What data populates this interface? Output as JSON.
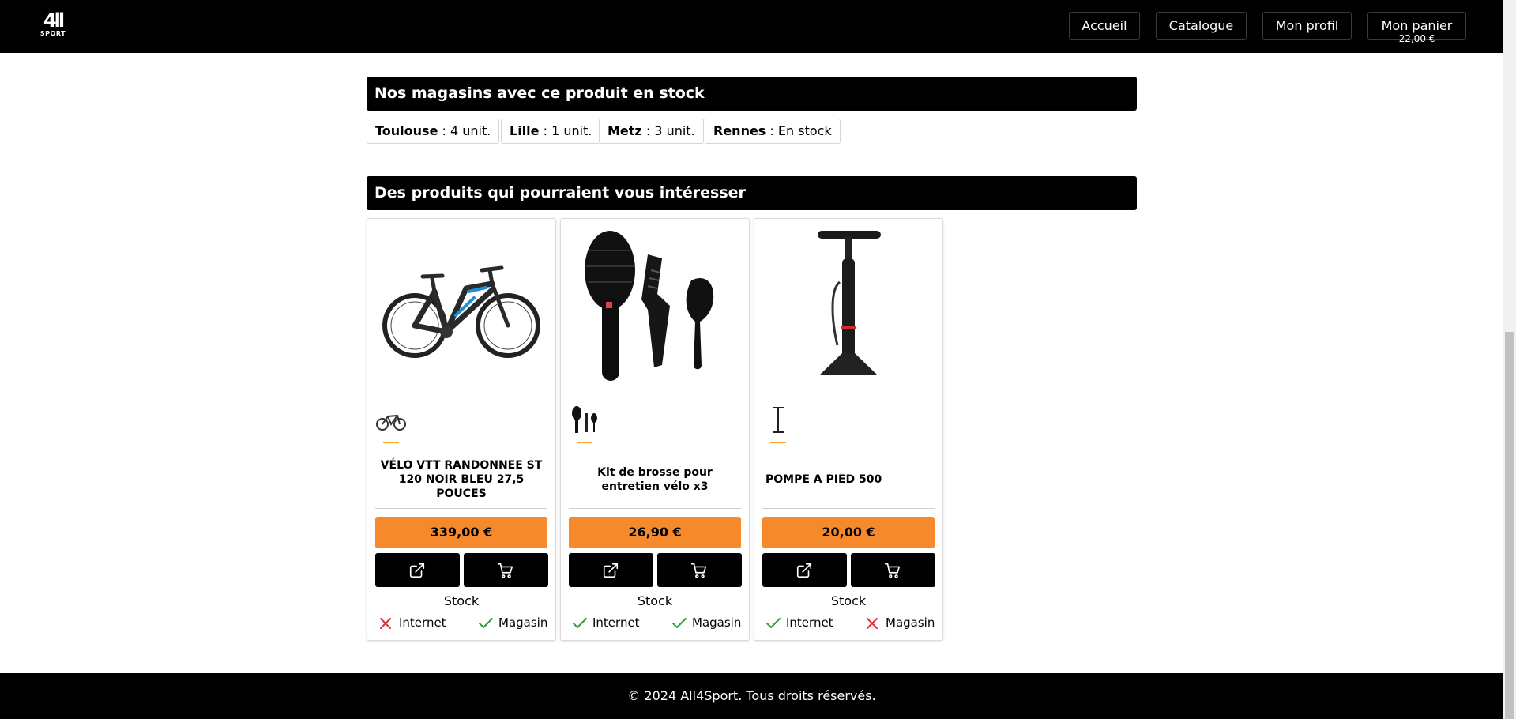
{
  "header": {
    "logo_top": "4ll",
    "logo_bottom": "SPORT",
    "nav": [
      {
        "label": "Accueil"
      },
      {
        "label": "Catalogue"
      },
      {
        "label": "Mon profil"
      },
      {
        "label": "Mon panier"
      }
    ],
    "cart_total": "22,00 €"
  },
  "stores_section": {
    "title": "Nos magasins avec ce produit en stock",
    "stores": [
      {
        "city": "Toulouse",
        "stock": " : 4 unit."
      },
      {
        "city": "Lille",
        "stock": " : 1 unit."
      },
      {
        "city": "Metz",
        "stock": " : 3 unit."
      },
      {
        "city": "Rennes",
        "stock": " : En stock"
      }
    ]
  },
  "related_section": {
    "title": "Des produits qui pourraient vous intéresser",
    "products": [
      {
        "name": "VÉLO VTT RANDONNEE ST 120 NOIR BLEU 27,5 POUCES",
        "price": "339,00 €",
        "image_icon": "mountain-bike",
        "stock_label": "Stock",
        "internet_label": "Internet",
        "internet_available": false,
        "store_label": "Magasin",
        "store_available": true
      },
      {
        "name": "Kit de brosse pour entretien vélo x3",
        "price": "26,90 €",
        "image_icon": "brush-kit",
        "stock_label": "Stock",
        "internet_label": "Internet",
        "internet_available": true,
        "store_label": "Magasin",
        "store_available": true
      },
      {
        "name": "POMPE A PIED 500",
        "price": "20,00 €",
        "image_icon": "floor-pump",
        "stock_label": "Stock",
        "internet_label": "Internet",
        "internet_available": true,
        "store_label": "Magasin",
        "store_available": false
      }
    ]
  },
  "footer": {
    "text": "© 2024 All4Sport. Tous droits réservés."
  },
  "colors": {
    "price_bg": "#f7892d",
    "check": "#2e9e3e",
    "cross": "#e0303a",
    "thumb_underline": "#f7a01f"
  }
}
